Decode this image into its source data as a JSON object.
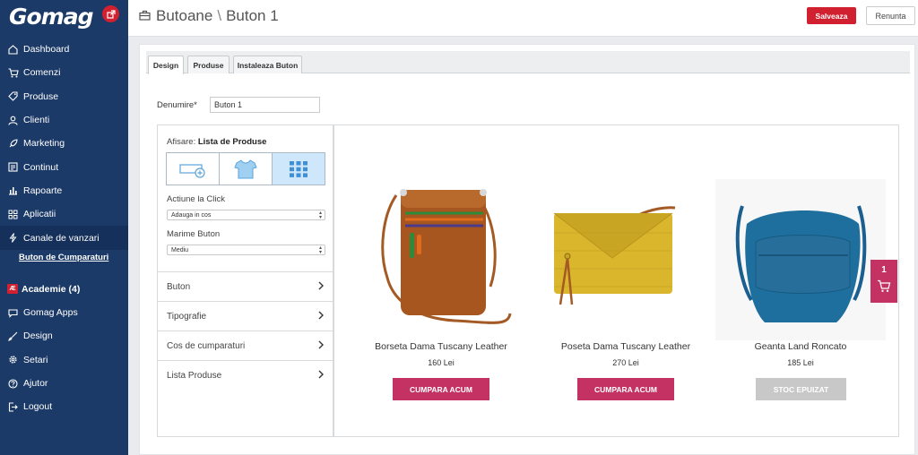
{
  "brand": {
    "name": "Gomag",
    "accent": "#d1202f",
    "sidebar_bg": "#1c3a67"
  },
  "sidebar": {
    "items": [
      {
        "label": "Dashboard",
        "icon": "dashboard-icon"
      },
      {
        "label": "Comenzi",
        "icon": "cart-icon"
      },
      {
        "label": "Produse",
        "icon": "tag-icon"
      },
      {
        "label": "Clienti",
        "icon": "user-icon"
      },
      {
        "label": "Marketing",
        "icon": "rocket-icon"
      },
      {
        "label": "Continut",
        "icon": "content-icon"
      },
      {
        "label": "Rapoarte",
        "icon": "chart-icon"
      },
      {
        "label": "Aplicatii",
        "icon": "apps-icon"
      },
      {
        "label": "Canale de vanzari",
        "icon": "bolt-icon"
      }
    ],
    "active_sub": "Buton de Cumparaturi",
    "items2": [
      {
        "label": "Academie (4)",
        "icon": "academie-icon",
        "badge": "Æ"
      },
      {
        "label": "Gomag Apps",
        "icon": "chat-icon"
      },
      {
        "label": "Design",
        "icon": "brush-icon"
      },
      {
        "label": "Setari",
        "icon": "gear-icon"
      },
      {
        "label": "Ajutor",
        "icon": "help-icon"
      },
      {
        "label": "Logout",
        "icon": "logout-icon"
      }
    ]
  },
  "header": {
    "breadcrumb_parent": "Butoane",
    "breadcrumb_sep": "\\",
    "breadcrumb_current": "Buton 1",
    "save_label": "Salveaza",
    "cancel_label": "Renunta"
  },
  "tabs": [
    {
      "label": "Design"
    },
    {
      "label": "Produse"
    },
    {
      "label": "Instaleaza Buton"
    }
  ],
  "form": {
    "name_label": "Denumire*",
    "name_value": "Buton 1"
  },
  "settings": {
    "display_prefix": "Afisare:",
    "display_value": "Lista de Produse",
    "modes": [
      "single-button-icon",
      "tshirt-icon",
      "grid-icon"
    ],
    "click_action_label": "Actiune la Click",
    "click_action_value": "Adauga in cos",
    "button_size_label": "Marime Buton",
    "button_size_value": "Mediu",
    "sections": [
      "Buton",
      "Tipografie",
      "Cos de cumparaturi",
      "Lista Produse"
    ]
  },
  "preview": {
    "products": [
      {
        "name": "Borseta Dama Tuscany Leather",
        "price": "160 Lei",
        "button": "CUMPARA ACUM",
        "in_stock": true
      },
      {
        "name": "Poseta Dama Tuscany Leather",
        "price": "270 Lei",
        "button": "CUMPARA ACUM",
        "in_stock": true
      },
      {
        "name": "Geanta Land Roncato",
        "price": "185 Lei",
        "button": "STOC EPUIZAT",
        "in_stock": false
      }
    ],
    "buy_color": "#c33263",
    "out_of_stock_color": "#c8c8c8",
    "cart_count": "1"
  }
}
